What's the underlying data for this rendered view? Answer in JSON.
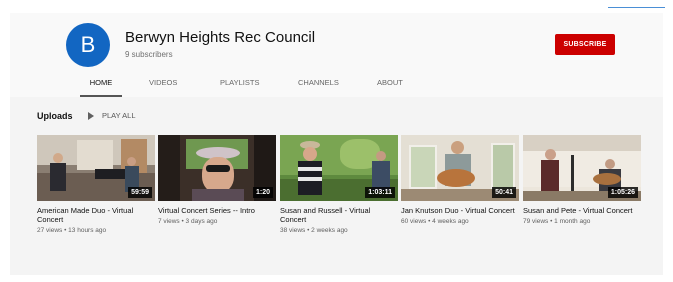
{
  "channel": {
    "avatar_letter": "B",
    "name": "Berwyn Heights Rec Council",
    "subscribers": "9 subscribers",
    "subscribe_label": "SUBSCRIBE"
  },
  "tabs": [
    {
      "label": "HOME",
      "active": true
    },
    {
      "label": "VIDEOS",
      "active": false
    },
    {
      "label": "PLAYLISTS",
      "active": false
    },
    {
      "label": "CHANNELS",
      "active": false
    },
    {
      "label": "ABOUT",
      "active": false
    }
  ],
  "uploads": {
    "title": "Uploads",
    "play_all_label": "PLAY ALL",
    "play_icon": "play-icon"
  },
  "videos": [
    {
      "title": "American Made Duo - Virtual Concert",
      "duration": "59:59",
      "views": "27 views",
      "age": "13 hours ago",
      "meta": "27 views • 13 hours ago"
    },
    {
      "title": "Virtual Concert Series -- Intro",
      "duration": "1:20",
      "views": "7 views",
      "age": "3 days ago",
      "meta": "7 views • 3 days ago"
    },
    {
      "title": "Susan and Russell - Virtual Concert",
      "duration": "1:03:11",
      "views": "38 views",
      "age": "2 weeks ago",
      "meta": "38 views • 2 weeks ago"
    },
    {
      "title": "Jan Knutson Duo - Virtual Concert",
      "duration": "50:41",
      "views": "60 views",
      "age": "4 weeks ago",
      "meta": "60 views • 4 weeks ago"
    },
    {
      "title": "Susan and Pete - Virtual Concert",
      "duration": "1:05:26",
      "views": "79 views",
      "age": "1 month ago",
      "meta": "79 views • 1 month ago"
    }
  ],
  "colors": {
    "avatar": "#1266c2",
    "subscribe": "#cc0000",
    "header_bg": "#f9f9f9",
    "content_bg": "#f4f4f4"
  }
}
